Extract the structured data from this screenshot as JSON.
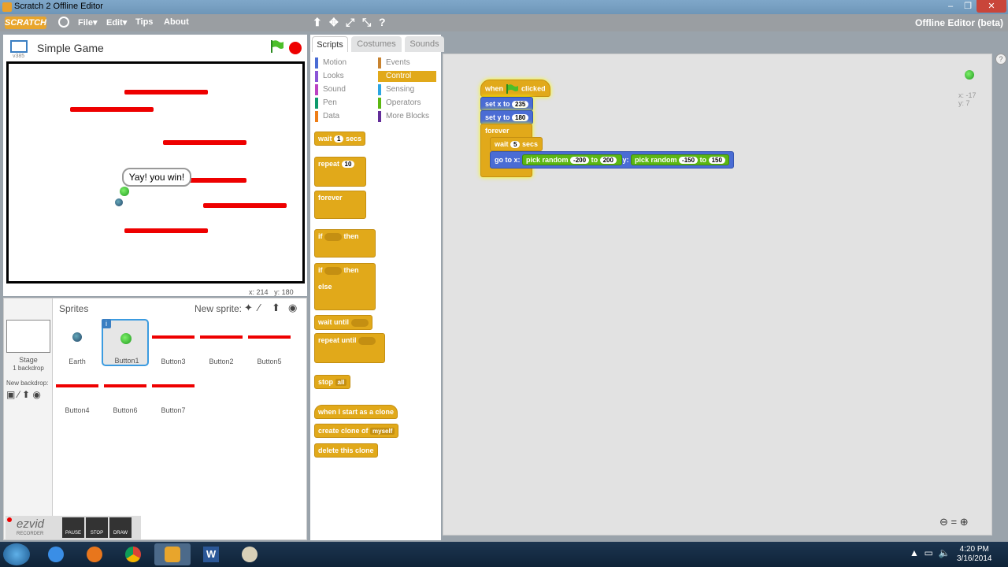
{
  "window": {
    "title": "Scratch 2 Offline Editor",
    "min": "–",
    "max": "❐",
    "close": "✕"
  },
  "menubar": {
    "logo": "SCRATCH",
    "file": "File▾",
    "edit": "Edit▾",
    "tips": "Tips",
    "about": "About",
    "tools": [
      "⬆",
      "✥",
      "⤢",
      "⤡",
      "?"
    ],
    "editor_title": "Offline Editor (beta)"
  },
  "stage": {
    "project_title": "Simple Game",
    "version": "v385",
    "bubble_text": "Yay! you win!",
    "mouse_x_label": "x:",
    "mouse_x": "214",
    "mouse_y_label": "y:",
    "mouse_y": "180"
  },
  "sprite_pane": {
    "sprites_label": "Sprites",
    "new_sprite_label": "New sprite:",
    "stage_label": "Stage",
    "backdrops": "1 backdrop",
    "new_backdrop": "New backdrop:",
    "sprites": [
      {
        "name": "Earth"
      },
      {
        "name": "Button1"
      },
      {
        "name": "Button3"
      },
      {
        "name": "Button2"
      },
      {
        "name": "Button5"
      },
      {
        "name": "Button4"
      },
      {
        "name": "Button6"
      },
      {
        "name": "Button7"
      }
    ]
  },
  "recorder": {
    "brand": "ezvid",
    "sub": "RECORDER",
    "pause": "PAUSE",
    "stop": "STOP",
    "draw": "DRAW"
  },
  "tabs": {
    "scripts": "Scripts",
    "costumes": "Costumes",
    "sounds": "Sounds"
  },
  "categories": {
    "motion": "Motion",
    "looks": "Looks",
    "sound": "Sound",
    "pen": "Pen",
    "data": "Data",
    "events": "Events",
    "control": "Control",
    "sensing": "Sensing",
    "operators": "Operators",
    "more": "More Blocks"
  },
  "palette": {
    "wait": "wait",
    "wait_val": "1",
    "secs": "secs",
    "repeat": "repeat",
    "repeat_val": "10",
    "forever": "forever",
    "if": "if",
    "then": "then",
    "else": "else",
    "wait_until": "wait until",
    "repeat_until": "repeat until",
    "stop": "stop",
    "stop_val": "all",
    "clone_start": "when I start as a clone",
    "create_clone": "create clone of",
    "create_clone_val": "myself",
    "delete_clone": "delete this clone"
  },
  "script": {
    "when": "when",
    "clicked": "clicked",
    "set_x": "set x to",
    "set_x_val": "235",
    "set_y": "set y to",
    "set_y_val": "180",
    "forever": "forever",
    "wait": "wait",
    "wait_val": "5",
    "secs": "secs",
    "goto": "go to x:",
    "pick1": "pick random",
    "r1a": "-200",
    "to1": "to",
    "r1b": "200",
    "y_label": "y:",
    "pick2": "pick random",
    "r2a": "-150",
    "to2": "to",
    "r2b": "150",
    "sprite_x": "x: -17",
    "sprite_y": "y: 7"
  },
  "taskbar": {
    "time": "4:20 PM",
    "date": "3/16/2014"
  },
  "colors": {
    "motion": "#4a6cd4",
    "control": "#e1a91a",
    "operators": "#5cb712"
  }
}
